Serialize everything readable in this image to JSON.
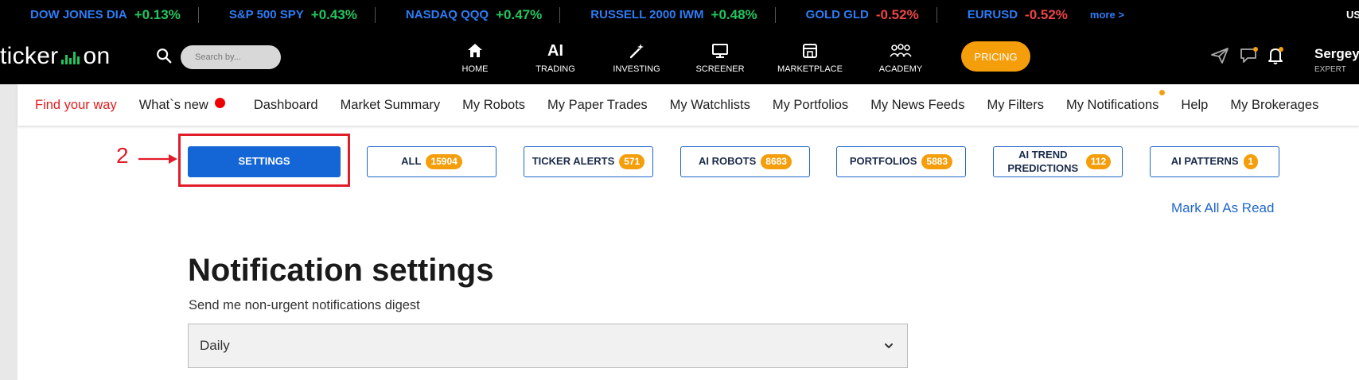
{
  "ticker": {
    "items": [
      {
        "name": "DOW JONES DIA",
        "change": "+0.13%",
        "dir": "up"
      },
      {
        "name": "S&P 500 SPY",
        "change": "+0.43%",
        "dir": "up"
      },
      {
        "name": "NASDAQ QQQ",
        "change": "+0.47%",
        "dir": "up"
      },
      {
        "name": "RUSSELL 2000 IWM",
        "change": "+0.48%",
        "dir": "up"
      },
      {
        "name": "GOLD GLD",
        "change": "-0.52%",
        "dir": "down"
      },
      {
        "name": "EURUSD",
        "change": "-0.52%",
        "dir": "down"
      }
    ],
    "more": "more >",
    "cut_text": "US"
  },
  "header": {
    "logo_left": "ticker",
    "logo_right": "on",
    "search_placeholder": "Search by...",
    "nav": [
      {
        "label": "HOME",
        "icon": "home-icon"
      },
      {
        "label": "TRADING",
        "icon": "ai-icon",
        "glyph": "AI"
      },
      {
        "label": "INVESTING",
        "icon": "magic-wand-icon"
      },
      {
        "label": "SCREENER",
        "icon": "monitor-icon"
      },
      {
        "label": "MARKETPLACE",
        "icon": "store-icon"
      },
      {
        "label": "ACADEMY",
        "icon": "group-icon"
      }
    ],
    "pricing": "PRICING",
    "user_name": "Sergey",
    "user_role": "EXPERT"
  },
  "menu": {
    "items": [
      "Find your way",
      "What`s new",
      "Dashboard",
      "Market Summary",
      "My Robots",
      "My Paper Trades",
      "My Watchlists",
      "My Portfolios",
      "My News Feeds",
      "My Filters",
      "My Notifications",
      "Help",
      "My Brokerages"
    ]
  },
  "annotation": {
    "number": "2"
  },
  "tabs": [
    {
      "label": "SETTINGS",
      "badge": ""
    },
    {
      "label": "ALL",
      "badge": "15904"
    },
    {
      "label": "TICKER ALERTS",
      "badge": "571"
    },
    {
      "label": "AI ROBOTS",
      "badge": "8683"
    },
    {
      "label": "PORTFOLIOS",
      "badge": "5883"
    },
    {
      "label": "AI TREND PREDICTIONS",
      "badge": "112"
    },
    {
      "label": "AI PATTERNS",
      "badge": "1"
    }
  ],
  "mark_all_read": "Mark All As Read",
  "settings": {
    "title": "Notification settings",
    "subtitle": "Send me non-urgent notifications digest",
    "digest_value": "Daily"
  },
  "colors": {
    "accent_blue": "#1466d6",
    "orange": "#f59e0b",
    "up_green": "#22c55e",
    "down_red": "#ef4444",
    "annotation_red": "#e11d2a"
  }
}
